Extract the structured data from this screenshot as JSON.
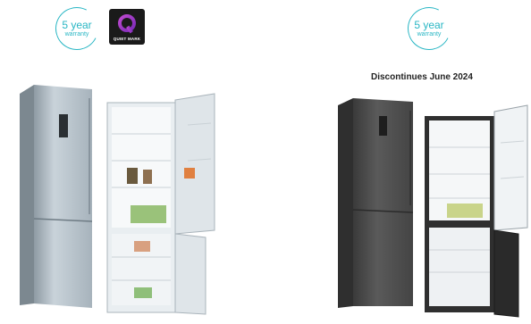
{
  "left_product": {
    "warranty_badge": {
      "big": "5 year",
      "small": "warranty"
    },
    "quiet_mark": {
      "label": "QUIET MARK",
      "icon": "quiet-mark-q-icon"
    },
    "image": "silver-fridge-freezer-closed-and-open"
  },
  "right_product": {
    "warranty_badge": {
      "big": "5 year",
      "small": "warranty"
    },
    "notice": "Discontinues June 2024",
    "image": "black-steel-fridge-freezer-closed-and-open"
  },
  "colors": {
    "badge_teal": "#28b6c4",
    "silver": "#b8c4cc",
    "dark_steel": "#4a4a4a"
  }
}
